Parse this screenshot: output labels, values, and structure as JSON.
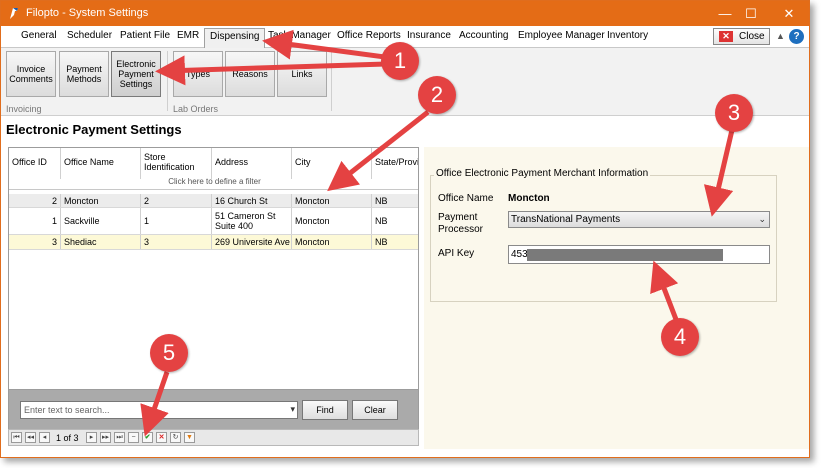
{
  "window": {
    "title": "Filopto - System Settings",
    "minimize": "—",
    "maximize": "☐",
    "close": "✕"
  },
  "tabs": [
    {
      "label": "General"
    },
    {
      "label": "Scheduler"
    },
    {
      "label": "Patient File"
    },
    {
      "label": "EMR"
    },
    {
      "label": "Dispensing",
      "active": true
    },
    {
      "label": "Task Manager"
    },
    {
      "label": "Office Reports"
    },
    {
      "label": "Insurance"
    },
    {
      "label": "Accounting"
    },
    {
      "label": "Employee Manager"
    },
    {
      "label": "Inventory"
    }
  ],
  "close_button": "Close",
  "ribbon": {
    "invoicing_buttons": [
      "Invoice Comments",
      "Payment Methods",
      "Electronic Payment Settings"
    ],
    "lab_buttons": [
      "Types",
      "Reasons",
      "Links"
    ],
    "invoicing_label": "Invoicing",
    "lab_label": "Lab Orders"
  },
  "page_title": "Electronic Payment Settings",
  "grid": {
    "headers": [
      "Office ID",
      "Office Name",
      "Store Identification",
      "Address",
      "City",
      "State/Provi"
    ],
    "filter_hint": "Click here to define a filter",
    "rows": [
      {
        "office_id": "2",
        "office_name": "Moncton",
        "store_id": "2",
        "address": "16 Church St",
        "city": "Moncton",
        "state": "NB"
      },
      {
        "office_id": "1",
        "office_name": "Sackville",
        "store_id": "1",
        "address": "51 Cameron St Suite 400",
        "city": "Moncton",
        "state": "NB"
      },
      {
        "office_id": "3",
        "office_name": "Shediac",
        "store_id": "3",
        "address": "269 Universite Ave",
        "city": "Moncton",
        "state": "NB"
      }
    ]
  },
  "search": {
    "placeholder": "Enter text to search...",
    "find": "Find",
    "clear": "Clear"
  },
  "pager": {
    "text": "1 of 3"
  },
  "merchant": {
    "legend": "Office Electronic Payment Merchant Information",
    "office_name_label": "Office Name",
    "office_name_value": "Moncton",
    "processor_label": "Payment Processor",
    "processor_value": "TransNational Payments",
    "api_key_label": "API Key",
    "api_key_value": "453"
  },
  "annotations": [
    "1",
    "2",
    "3",
    "4",
    "5"
  ],
  "colors": {
    "titlebar": "#e46c16",
    "annotation": "#e44242",
    "panel": "#fbf8ec",
    "highlight_row": "#fdf9d7"
  }
}
